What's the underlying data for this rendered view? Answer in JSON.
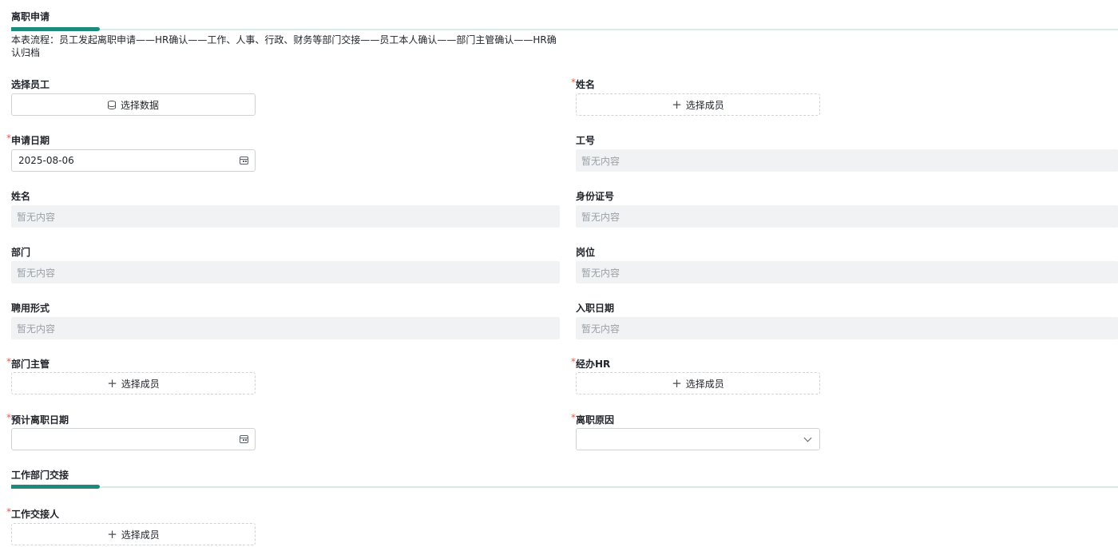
{
  "sections": {
    "resignation": "离职申请",
    "handover": "工作部门交接"
  },
  "description": "本表流程：员工发起离职申请——HR确认——工作、人事、行政、财务等部门交接——员工本人确认——部门主管确认——HR确认归档",
  "required_mark": "*",
  "empty_text": "暂无内容",
  "select_member_label": "选择成员",
  "fields": {
    "select_employee": {
      "label": "选择员工",
      "button": "选择数据"
    },
    "name_top": {
      "label": "姓名"
    },
    "apply_date": {
      "label": "申请日期",
      "value": "2025-08-06"
    },
    "employee_no": {
      "label": "工号"
    },
    "name": {
      "label": "姓名"
    },
    "id_number": {
      "label": "身份证号"
    },
    "department": {
      "label": "部门"
    },
    "position": {
      "label": "岗位"
    },
    "employment_type": {
      "label": "聘用形式"
    },
    "hire_date": {
      "label": "入职日期"
    },
    "dept_manager": {
      "label": "部门主管"
    },
    "handling_hr": {
      "label": "经办HR"
    },
    "planned_leave_date": {
      "label": "预计离职日期",
      "value": ""
    },
    "leave_reason": {
      "label": "离职原因",
      "value": ""
    },
    "handover_person": {
      "label": "工作交接人"
    }
  }
}
